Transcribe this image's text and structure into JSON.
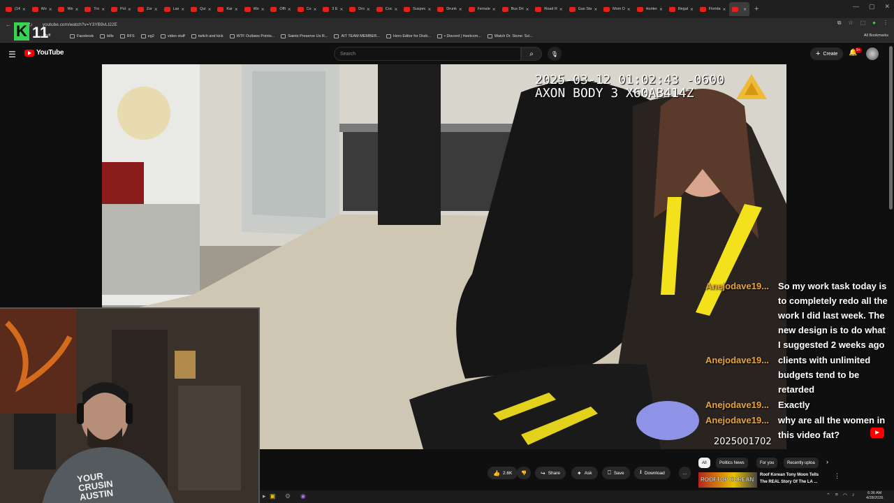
{
  "browser": {
    "tabs": [
      {
        "label": "(14"
      },
      {
        "label": "Wo"
      },
      {
        "label": "We"
      },
      {
        "label": "Tro"
      },
      {
        "label": "Pol"
      },
      {
        "label": "Zor"
      },
      {
        "label": "Las"
      },
      {
        "label": "Qui"
      },
      {
        "label": "Kar"
      },
      {
        "label": "Wo"
      },
      {
        "label": "Offi"
      },
      {
        "label": "Co"
      },
      {
        "label": "3 E"
      },
      {
        "label": "Dro"
      },
      {
        "label": "Coc"
      },
      {
        "label": "Suspec"
      },
      {
        "label": "Drunk"
      },
      {
        "label": "Female"
      },
      {
        "label": "Bus Dri"
      },
      {
        "label": "Road R"
      },
      {
        "label": "Gas Sta"
      },
      {
        "label": "Mom D"
      },
      {
        "label": "Hunter"
      },
      {
        "label": "Illegal"
      },
      {
        "label": "Florida"
      },
      {
        "label": ""
      }
    ],
    "new_tab": "+",
    "window_controls": [
      "—",
      "▢",
      "✕"
    ],
    "url": "youtube.com/watch?v=Y3YB9vLI22E",
    "bookmarks": [
      {
        "label": "Facebook"
      },
      {
        "label": "bills"
      },
      {
        "label": "RFS"
      },
      {
        "label": "eg2"
      },
      {
        "label": "video stuff"
      },
      {
        "label": "twitch and kick"
      },
      {
        "label": "WTF Outlaws Points..."
      },
      {
        "label": "Saints Preserve Us R..."
      },
      {
        "label": "AIT TEAM MEMBER..."
      },
      {
        "label": "Hero Editor for Disib..."
      },
      {
        "label": "• Discord | #welcom..."
      },
      {
        "label": "Watch Dr. Stone: Sci..."
      }
    ],
    "all_bookmarks": "All Bookmarks",
    "bookmark_first": "stuff"
  },
  "overlay_logo": {
    "letter": "K",
    "number": "11"
  },
  "youtube": {
    "wordmark": "YouTube",
    "search_placeholder": "Search",
    "create_label": "Create",
    "notif_badge": "9+"
  },
  "video": {
    "timestamp": "2025-03-12 01:02:43 -0600",
    "device": "AXON BODY 3 X60AB414Z",
    "video_id": "2025001702"
  },
  "chat": [
    {
      "user": "Anejodave19...",
      "lines": [
        "So my work task today is",
        "to completely redo all the",
        "work I did last week. The",
        "new design is to do what",
        "I suggested 2 weeks ago"
      ]
    },
    {
      "user": "Anejodave19...",
      "lines": [
        "clients with unlimited",
        "budgets tend to be",
        "retarded"
      ]
    },
    {
      "user": "Anejodave19...",
      "lines": [
        "Exactly"
      ]
    },
    {
      "user": "Anejodave19...",
      "lines": [
        "why are all the women in",
        "this video fat?"
      ]
    }
  ],
  "actions": {
    "like_count": "2.6K",
    "share": "Share",
    "ask": "Ask",
    "save": "Save",
    "download": "Download",
    "more": "…"
  },
  "filter_chips": [
    {
      "label": "All",
      "selected": true
    },
    {
      "label": "Politics News",
      "selected": false
    },
    {
      "label": "For you",
      "selected": false
    },
    {
      "label": "Recently uploa",
      "selected": false
    }
  ],
  "recommendation": {
    "thumb_text": "ROOFTOP KOREAN",
    "title_line1": "Roof Korean Tony Moon Tells",
    "title_line2": "The REAL Story Of The LA ..."
  },
  "webcam": {
    "shirt_line1": "YOUR",
    "shirt_line2": "CRUSIN",
    "shirt_line3": "AUSTIN"
  },
  "taskbar": {
    "clock_time": "6:36 AM",
    "clock_date": "4/28/2026"
  },
  "colors": {
    "chat_user": "#e8a23a",
    "yt_red": "#ff0000",
    "k_green": "#39d353"
  }
}
